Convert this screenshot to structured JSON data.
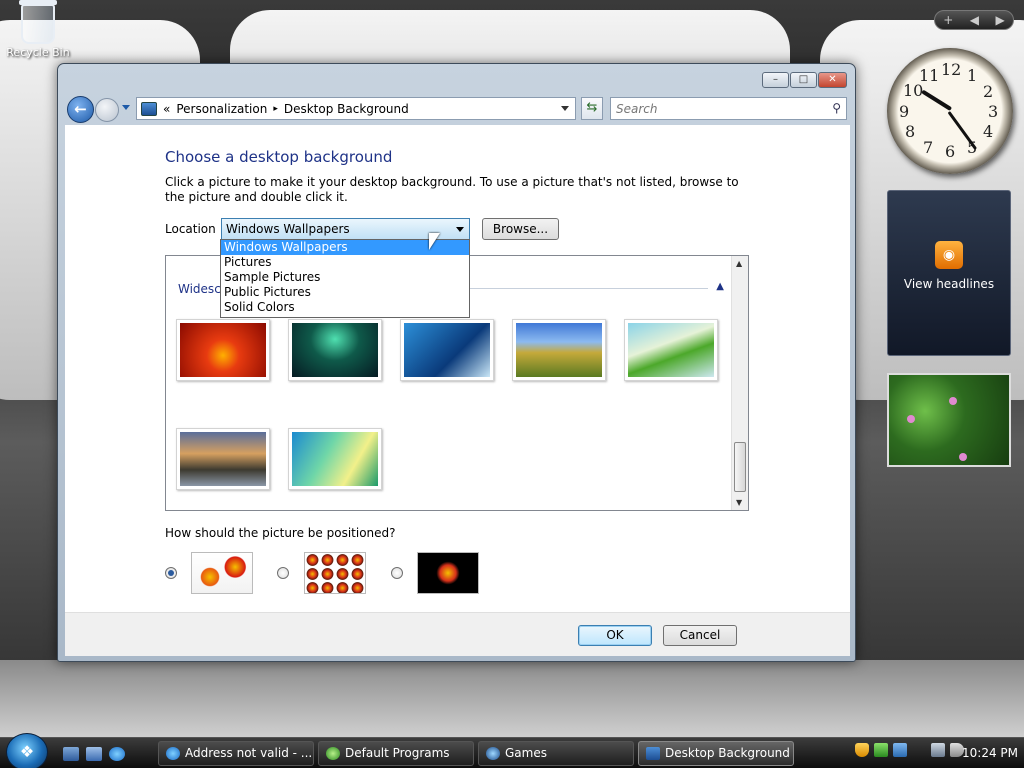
{
  "desktop": {
    "recycle_bin_label": "Recycle Bin"
  },
  "sidebar": {
    "controls": {
      "add": "+",
      "prev": "◀",
      "next": "▶"
    },
    "clock": {
      "numbers": [
        "12",
        "1",
        "2",
        "3",
        "4",
        "5",
        "6",
        "7",
        "8",
        "9",
        "10",
        "11"
      ]
    },
    "feed": {
      "label": "View headlines"
    }
  },
  "window": {
    "caption": {
      "minimize": "–",
      "maximize": "□",
      "close": "✕"
    },
    "breadcrumb": {
      "prefix": "«",
      "items": [
        "Personalization",
        "Desktop Background"
      ],
      "separator": "▸"
    },
    "search_placeholder": "Search",
    "heading": "Choose a desktop background",
    "description": "Click a picture to make it your desktop background. To use a picture that's not listed, browse to the picture and double click it.",
    "location_label": "Location",
    "location_value": "Windows Wallpapers",
    "location_options": [
      "Windows Wallpapers",
      "Pictures",
      "Sample Pictures",
      "Public Pictures",
      "Solid Colors"
    ],
    "browse_label": "Browse...",
    "group_label": "Widescreen",
    "position_question": "How should the picture be positioned?",
    "ok_label": "OK",
    "cancel_label": "Cancel"
  },
  "taskbar": {
    "tasks": [
      "Address not valid - ...",
      "Default Programs",
      "Games",
      "Desktop Background"
    ],
    "time": "10:24 PM"
  }
}
